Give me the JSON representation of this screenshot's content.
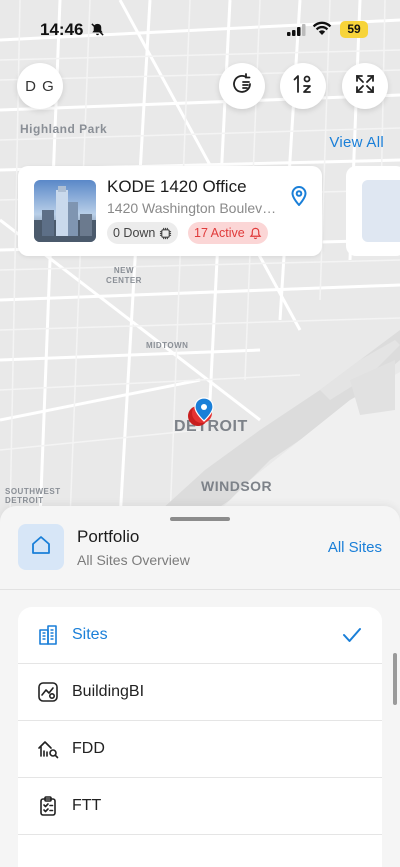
{
  "status_bar": {
    "time": "14:46",
    "battery": "59"
  },
  "header": {
    "avatar_initials": "D G",
    "view_all": "View All"
  },
  "map": {
    "labels": {
      "highland_park": "Highland Park",
      "new_center": "NEW CENTER",
      "midtown": "MIDTOWN",
      "detroit": "DETROIT",
      "windsor": "WINDSOR",
      "southwest": "SOUTHWEST DETROIT"
    }
  },
  "site_card": {
    "title": "KODE 1420 Office",
    "address": "1420 Washington Boulevard",
    "down_badge": "0 Down",
    "active_badge": "17 Active"
  },
  "portfolio": {
    "title": "Portfolio",
    "subtitle": "All Sites Overview",
    "all_sites": "All Sites"
  },
  "menu": {
    "items": [
      {
        "label": "Sites",
        "icon": "building-icon",
        "active": true
      },
      {
        "label": "BuildingBI",
        "icon": "chart-gear-icon",
        "active": false
      },
      {
        "label": "FDD",
        "icon": "fdd-icon",
        "active": false
      },
      {
        "label": "FTT",
        "icon": "clipboard-icon",
        "active": false
      }
    ]
  },
  "colors": {
    "accent": "#1a7fd8",
    "alert": "#e03a3a",
    "alert_bg": "#fbd6d6"
  }
}
